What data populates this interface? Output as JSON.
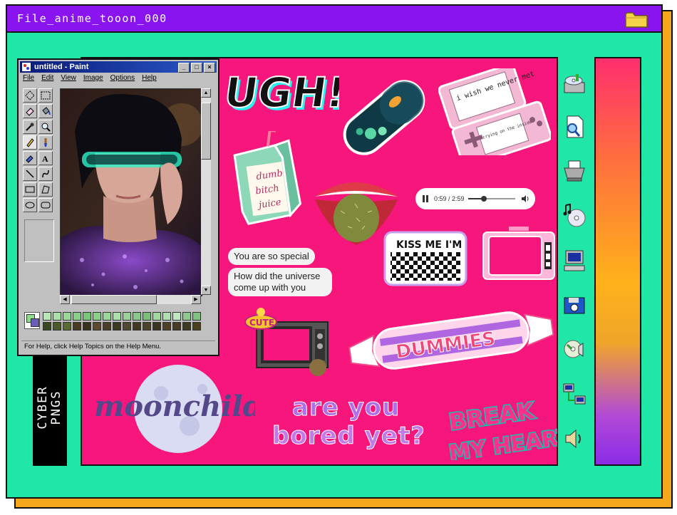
{
  "window": {
    "title": "File_anime_tooon_000"
  },
  "paint": {
    "title": "untitled - Paint",
    "menu": [
      "File",
      "Edit",
      "View",
      "Image",
      "Options",
      "Help"
    ],
    "status": "For Help, click Help Topics on the Help Menu."
  },
  "audio": {
    "time": "0:59 / 2:59",
    "progress": 0.33
  },
  "bubbles": [
    "You are so special",
    "How did the universe come up with you"
  ],
  "stickers": {
    "ugh": "UGH!",
    "juice": [
      "dumb",
      "bitch",
      "juice"
    ],
    "ds_screen_top": "i wish we never met",
    "ds_screen_bottom": "crying on the inside",
    "kiss": "KISS ME I'M",
    "cute": "CUTE",
    "dummies": "DUMMIES",
    "moonchild": "moonchild",
    "bored_line1": "are you",
    "bored_line2": "bored yet?",
    "break_line1": "BREAK",
    "break_line2": "MY HEART"
  },
  "cyber_label": [
    "CYBER",
    "PNGS"
  ],
  "colors": {
    "titlebar": "#8a14f0",
    "window_bg": "#20e6a6",
    "canvas": "#f7167b",
    "shadow": "#f6a81c"
  },
  "side_icons": [
    "cd-drive-icon",
    "document-search-icon",
    "printer-icon",
    "music-cd-icon",
    "computer-icon",
    "floppy-camera-icon",
    "cd-audio-icon",
    "network-icon",
    "speaker-icon"
  ]
}
